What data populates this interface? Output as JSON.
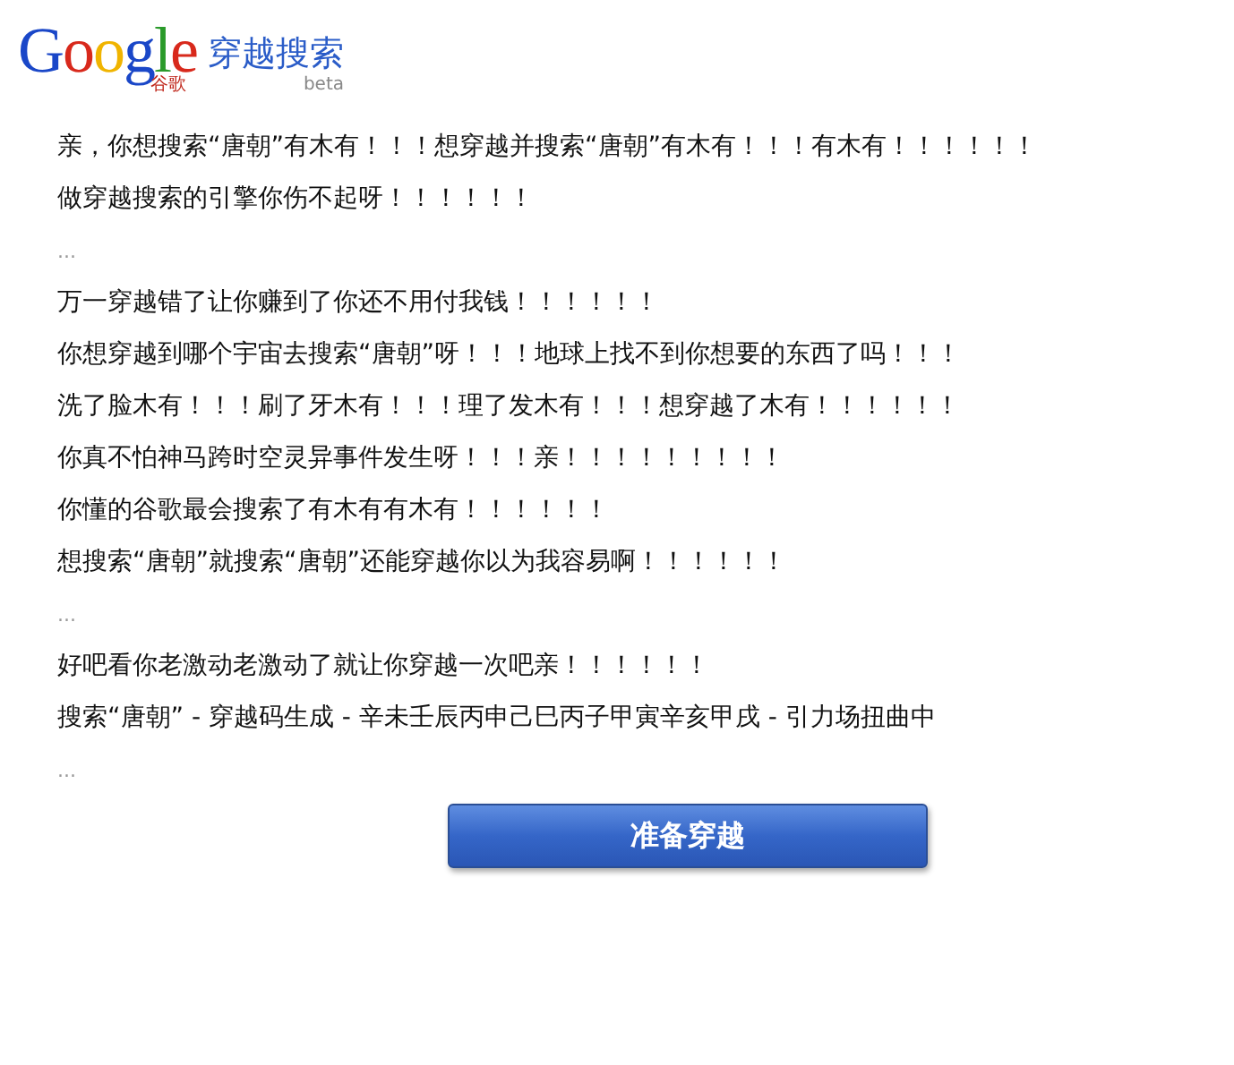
{
  "logo": {
    "wordmark": "Google",
    "subtitle": "谷歌",
    "product": "穿越搜索",
    "badge": "beta"
  },
  "lines": [
    {
      "kind": "text",
      "text": "亲，你想搜索“唐朝”有木有！！！想穿越并搜索“唐朝”有木有！！！有木有！！！！！！"
    },
    {
      "kind": "text",
      "text": "做穿越搜索的引擎你伤不起呀！！！！！！"
    },
    {
      "kind": "ellipsis",
      "text": "..."
    },
    {
      "kind": "text",
      "text": "万一穿越错了让你赚到了你还不用付我钱！！！！！！"
    },
    {
      "kind": "text",
      "text": "你想穿越到哪个宇宙去搜索“唐朝”呀！！！地球上找不到你想要的东西了吗！！！"
    },
    {
      "kind": "text",
      "text": "洗了脸木有！！！刷了牙木有！！！理了发木有！！！想穿越了木有！！！！！！"
    },
    {
      "kind": "text",
      "text": "你真不怕神马跨时空灵异事件发生呀！！！亲！！！！！！！！！"
    },
    {
      "kind": "text",
      "text": "你懂的谷歌最会搜索了有木有有木有！！！！！！"
    },
    {
      "kind": "text",
      "text": "想搜索“唐朝”就搜索“唐朝”还能穿越你以为我容易啊！！！！！！"
    },
    {
      "kind": "ellipsis",
      "text": "..."
    },
    {
      "kind": "text",
      "text": "好吧看你老激动老激动了就让你穿越一次吧亲！！！！！！"
    },
    {
      "kind": "text",
      "text": "搜索“唐朝” - 穿越码生成 - 辛未壬辰丙申己巳丙子甲寅辛亥甲戌 - 引力场扭曲中"
    },
    {
      "kind": "ellipsis",
      "text": "..."
    }
  ],
  "button": "准备穿越"
}
